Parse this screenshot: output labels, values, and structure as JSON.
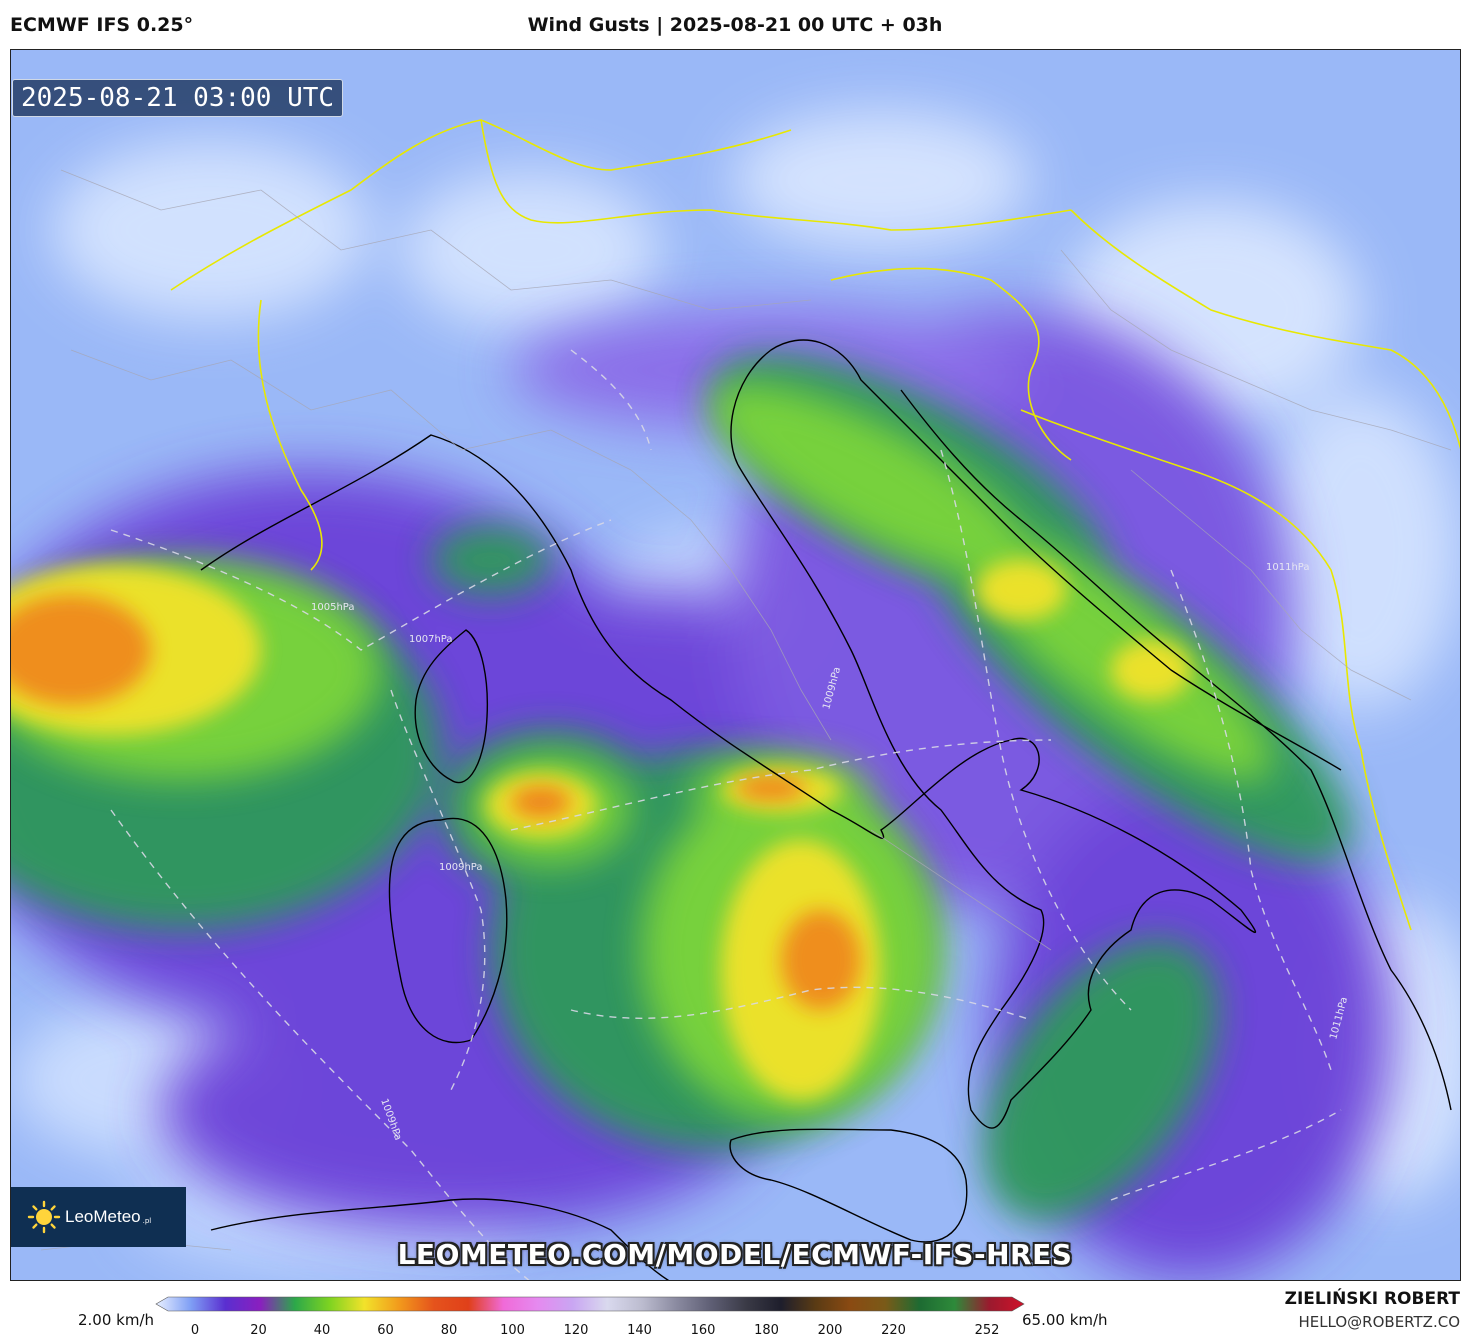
{
  "header": {
    "model": "ECMWF IFS 0.25°",
    "title": "Wind Gusts | 2025-08-21 00 UTC + 03h"
  },
  "map": {
    "timestamp": "2025-08-21 03:00 UTC",
    "watermark": "LEOMETEO.COM/MODEL/ECMWF-IFS-HRES",
    "isobars": [
      "1005hPa",
      "1007hPa",
      "1009hPa",
      "1009hPa",
      "1011hPa",
      "1009hPa",
      "1011hPa"
    ],
    "colors": {
      "calm": "#cfe0ff",
      "light": "#86a8f2",
      "moderate": "#6b3ed6",
      "fresh": "#2f9a5e",
      "strong": "#7fd63a",
      "very_strong": "#f2e22a",
      "gale": "#f0841c",
      "coastline": "#000000",
      "borders": "#e8e800",
      "regions": "#9a9a9a"
    }
  },
  "logo": {
    "name": "LeoMeteo",
    "suffix": ".pl",
    "icon": "sun-icon"
  },
  "legend": {
    "min_label": "2.00 km/h",
    "max_label": "65.00 km/h",
    "ticks": [
      "0",
      "20",
      "40",
      "60",
      "80",
      "100",
      "120",
      "140",
      "160",
      "180",
      "200",
      "220",
      "252"
    ],
    "stops": [
      "#e9f0ff",
      "#7f9ff5",
      "#5a2fd0",
      "#8a1fbf",
      "#2ca84a",
      "#7ed321",
      "#f2e22a",
      "#f29a1c",
      "#e5531c",
      "#e0401a",
      "#f06ad8",
      "#e58af0",
      "#c9a6f2",
      "#d9d9ee",
      "#bcbccf",
      "#8a8aa0",
      "#5e5e74",
      "#3a3a46",
      "#1e1e2c",
      "#5a3b14",
      "#8a4a12",
      "#7a5a18",
      "#1d6b32",
      "#2e8a3a",
      "#9a1a2e",
      "#d0122a"
    ]
  },
  "credits": {
    "author": "ZIELIŃSKI ROBERT",
    "email": "HELLO@ROBERTZ.CO"
  }
}
